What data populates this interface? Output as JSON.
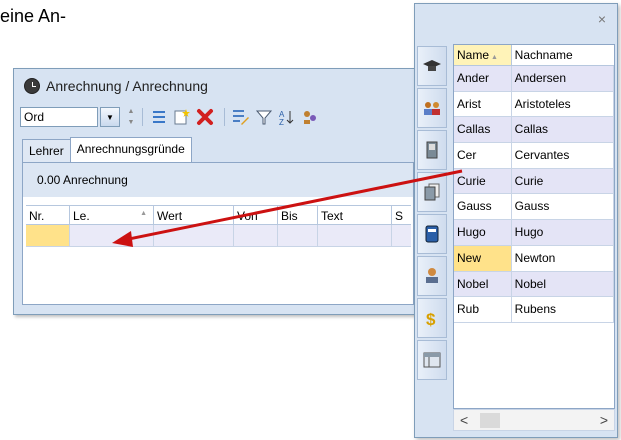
{
  "intro": "eine An-",
  "window": {
    "title": "Anrechnung / Anrechnung",
    "combo_value": "Ord",
    "tabs": [
      "Lehrer",
      "Anrechnungsgründe"
    ],
    "info": "0.00 Anrechnung",
    "columns": [
      "Nr.",
      "Le.",
      "Wert",
      "Von",
      "Bis",
      "Text",
      "S"
    ]
  },
  "side": {
    "close": "×",
    "headers": [
      "Name",
      "Nachname"
    ],
    "rows": [
      {
        "name": "Ander",
        "nachname": "Andersen"
      },
      {
        "name": "Arist",
        "nachname": "Aristoteles"
      },
      {
        "name": "Callas",
        "nachname": "Callas"
      },
      {
        "name": "Cer",
        "nachname": "Cervantes"
      },
      {
        "name": "Curie",
        "nachname": "Curie"
      },
      {
        "name": "Gauss",
        "nachname": "Gauss"
      },
      {
        "name": "Hugo",
        "nachname": "Hugo"
      },
      {
        "name": "New",
        "nachname": "Newton"
      },
      {
        "name": "Nobel",
        "nachname": "Nobel"
      },
      {
        "name": "Rub",
        "nachname": "Rubens"
      }
    ],
    "scroll_left": "<",
    "scroll_right": ">"
  },
  "colors": {
    "selection": "#ffe28a",
    "arrow": "#cc1111",
    "window_bg": "#d7e3f2"
  }
}
